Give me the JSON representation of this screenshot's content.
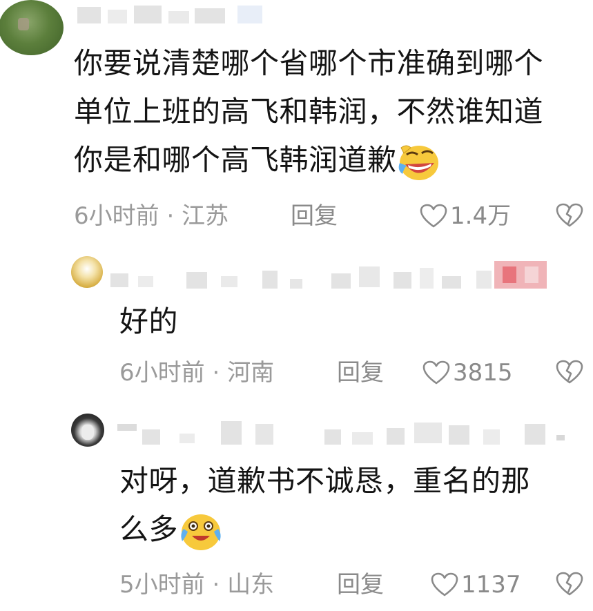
{
  "comments": [
    {
      "text_lines": [
        "你要说清楚哪个省哪个市准确到哪个",
        "单位上班的高飞和韩润，不然谁知道",
        "你是和哪个高飞韩润道歉"
      ],
      "emoji": "laughing-emoji",
      "time": "6小时前",
      "location": "江苏",
      "reply_label": "回复",
      "likes": "1.4万"
    },
    {
      "text_lines": [
        "好的"
      ],
      "time": "6小时前",
      "location": "河南",
      "reply_label": "回复",
      "likes": "3815"
    },
    {
      "text_lines": [
        "对呀，道歉书不诚恳，重名的那",
        "么多"
      ],
      "emoji": "crying-laughing-emoji",
      "time": "5小时前",
      "location": "山东",
      "reply_label": "回复",
      "likes": "1137"
    }
  ],
  "meta_separator": " · ",
  "colors": {
    "text": "#141414",
    "meta": "#9a9a9a",
    "badge": "#e8747c"
  }
}
